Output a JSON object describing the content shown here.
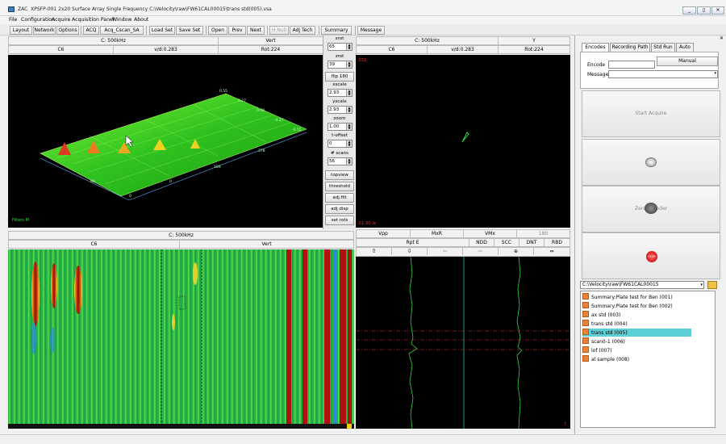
{
  "window": {
    "app": "ZAC",
    "title": "XPSFP-001 2x20 Surface Array Single Frequency  C:\\Velocity\\raw\\FW61CAL00015\\trans std(005).vsa",
    "minimize": "_",
    "restore": "▯",
    "close": "✕"
  },
  "menu": [
    "File",
    "Configuration",
    "Acquire",
    "Acquisition Panel",
    "Window",
    "About"
  ],
  "toolbar": {
    "layout": "Layout",
    "network": "Network",
    "options": "Options",
    "acq": "ACQ",
    "acq_cscan": "Acq_Cscan_SA",
    "load_set": "Load Set",
    "save_set": "Save Set",
    "open": "Open",
    "prev": "Prev",
    "next": "Next",
    "h_null": "H Null",
    "adj_tech": "Adj Tech",
    "summary": "Summary",
    "message": "Message"
  },
  "panel3d": {
    "header_freq": "C: 500kHz",
    "header_ch": "Vert",
    "c6": "C6",
    "vd": "v/d:0.283",
    "rot": "Rot:224",
    "filters": "Filters  M",
    "axis_labels": [
      "0.55",
      "0.27",
      "0.00",
      "-0.27",
      "-0.55",
      "378",
      "189",
      "0",
      "90",
      "0"
    ]
  },
  "controls": {
    "xrot_label": "xrot",
    "xrot": "65",
    "zrot_label": "zrot",
    "zrot": "39",
    "flip": "flip 180",
    "xscale_label": "xscale",
    "xscale": "2.93",
    "yscale_label": "yscale",
    "yscale": "2.93",
    "zoom_label": "zoom",
    "zoom": "1.00",
    "toffset_label": "t-offset",
    "toffset": "0",
    "scans_label": "# scans",
    "scans": "56",
    "topview": "topview",
    "threshold": "threshold",
    "adjfilt": "adj.filt",
    "adjdisp": "adj disp",
    "setrots": "set rots"
  },
  "panelLissajous": {
    "header_freq": "C: 500kHz",
    "header_ch": "Y",
    "c6": "C6",
    "vd": "v/d:0.283",
    "rot": "Rot:224",
    "top_label": "231",
    "bottom_label": "21.30 w"
  },
  "panelCscan": {
    "header_freq": "C: 500kHz",
    "c6": "C6",
    "vert": "Vert"
  },
  "panelStrip": {
    "vpp": "Vpp",
    "mxr": "MxR",
    "vmx": "VMx",
    "val180": "180",
    "rpt": "Rpt E",
    "ndd": "NDD",
    "scc": "SCC",
    "dnt": "DNT",
    "rbd": "RBD",
    "corner": "7"
  },
  "rightPanel": {
    "tabs": [
      "Encodes",
      "Recording Path",
      "Std Run",
      "Auto"
    ],
    "encode_label": "Encode",
    "message_label": "Message",
    "manual": "Manual",
    "start_acquire": "Start Acquire",
    "zero_encoder": "Zero Encoder",
    "stop": "STOP",
    "path": "C:\\Velocity\\raw\\FW61CAL00015",
    "files": [
      "Summary:Plate test for Ben (001)",
      "Summary:Plate test for Ben (002)",
      "ax std (003)",
      "trans std (004)",
      "trans std (005)",
      "scan0-1 (006)",
      "lof (007)",
      "al sample (008)"
    ]
  },
  "collapse_arrow": ">",
  "colors": {
    "accent_select": "#5cd0d8",
    "trace_green": "#34d24a",
    "marker_red": "#e53030"
  }
}
